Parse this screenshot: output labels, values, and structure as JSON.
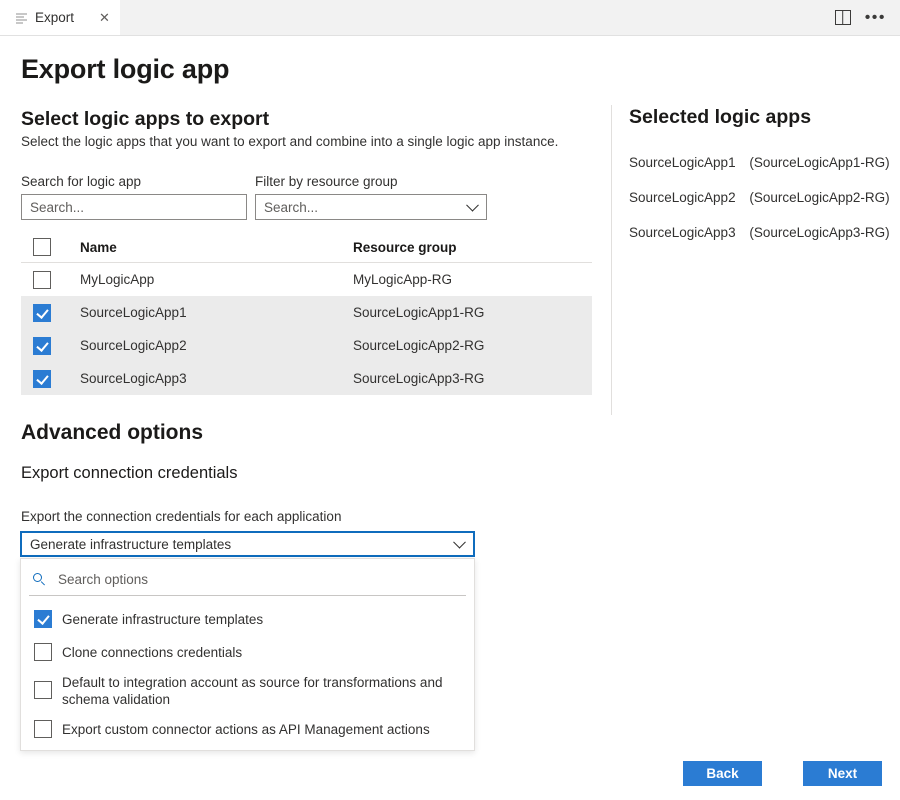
{
  "tab": {
    "title": "Export",
    "close_label": "✕",
    "lines_icon": "list-lines-icon",
    "split_icon": "split-view-icon",
    "more_label": "•••"
  },
  "page": {
    "title": "Export logic app"
  },
  "select_section": {
    "heading": "Select logic apps to export",
    "description": "Select the logic apps that you want to export and combine into a single logic app instance.",
    "search_label": "Search for logic app",
    "search_placeholder": "Search...",
    "filter_label": "Filter by resource group",
    "filter_placeholder": "Search..."
  },
  "table": {
    "columns": [
      "Name",
      "Resource group"
    ],
    "header_checkbox_checked": false,
    "rows": [
      {
        "name": "MyLogicApp",
        "resource_group": "MyLogicApp-RG",
        "checked": false
      },
      {
        "name": "SourceLogicApp1",
        "resource_group": "SourceLogicApp1-RG",
        "checked": true
      },
      {
        "name": "SourceLogicApp2",
        "resource_group": "SourceLogicApp2-RG",
        "checked": true
      },
      {
        "name": "SourceLogicApp3",
        "resource_group": "SourceLogicApp3-RG",
        "checked": true
      }
    ]
  },
  "selected_panel": {
    "heading": "Selected logic apps",
    "items": [
      {
        "name": "SourceLogicApp1",
        "resource_group": "(SourceLogicApp1-RG)"
      },
      {
        "name": "SourceLogicApp2",
        "resource_group": "(SourceLogicApp2-RG)"
      },
      {
        "name": "SourceLogicApp3",
        "resource_group": "(SourceLogicApp3-RG)"
      }
    ]
  },
  "advanced": {
    "heading": "Advanced options",
    "subheading": "Export connection credentials",
    "field_label": "Export the connection credentials for each application",
    "selected_value": "Generate infrastructure templates",
    "dropdown": {
      "search_placeholder": "Search options",
      "options": [
        {
          "label": "Generate infrastructure templates",
          "checked": true
        },
        {
          "label": "Clone connections credentials",
          "checked": false
        },
        {
          "label": "Default to integration account as source for transformations and schema validation",
          "checked": false
        },
        {
          "label": "Export custom connector actions as API Management actions",
          "checked": false
        }
      ]
    }
  },
  "footer": {
    "back_label": "Back",
    "next_label": "Next"
  },
  "colors": {
    "accent": "#2b7cd3",
    "focus_border": "#0f6cbd",
    "selected_row": "#ebebeb",
    "tabstrip": "#f2f2f2"
  }
}
